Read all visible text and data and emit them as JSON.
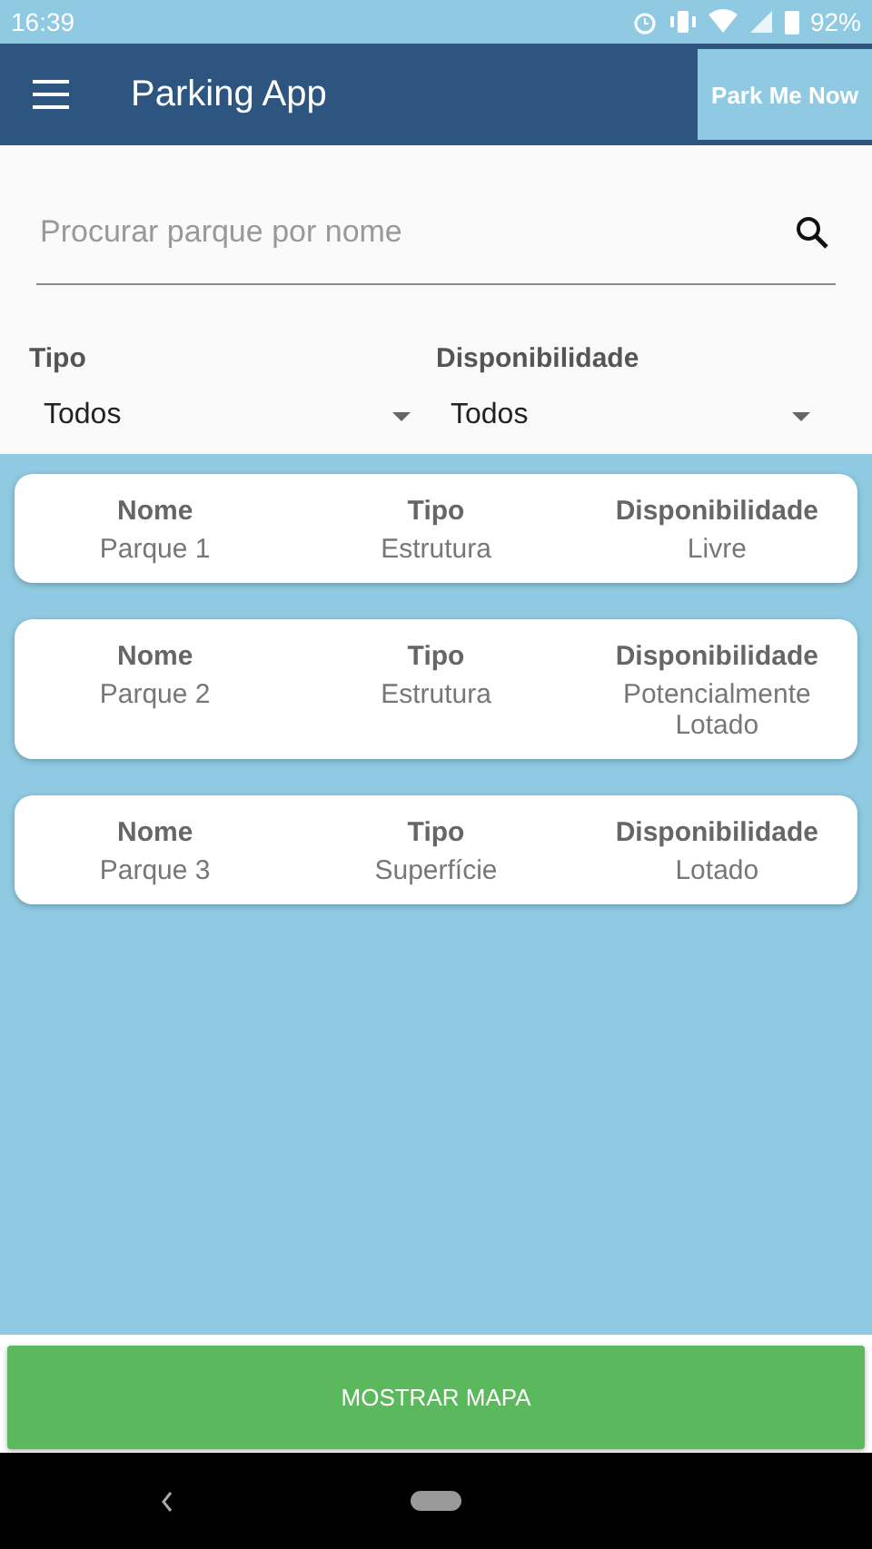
{
  "status_bar": {
    "time": "16:39",
    "battery": "92%"
  },
  "app_bar": {
    "title": "Parking App",
    "action": "Park Me Now"
  },
  "search": {
    "placeholder": "Procurar parque por nome"
  },
  "filters": [
    {
      "label": "Tipo",
      "value": "Todos"
    },
    {
      "label": "Disponibilidade",
      "value": "Todos"
    }
  ],
  "parks": [
    {
      "columns": [
        {
          "heading": "Nome",
          "value": "Parque 1"
        },
        {
          "heading": "Tipo",
          "value": "Estrutura"
        },
        {
          "heading": "Disponibilidade",
          "value": "Livre"
        }
      ]
    },
    {
      "columns": [
        {
          "heading": "Nome",
          "value": "Parque 2"
        },
        {
          "heading": "Tipo",
          "value": "Estrutura"
        },
        {
          "heading": "Disponibilidade",
          "value": "Potencialmente Lotado"
        }
      ]
    },
    {
      "columns": [
        {
          "heading": "Nome",
          "value": "Parque 3"
        },
        {
          "heading": "Tipo",
          "value": "Superfície"
        },
        {
          "heading": "Disponibilidade",
          "value": "Lotado"
        }
      ]
    }
  ],
  "map_button": "MOSTRAR MAPA"
}
